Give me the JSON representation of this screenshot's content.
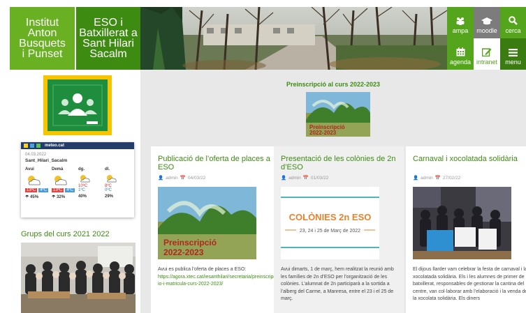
{
  "colors": {
    "green": "#55a51c",
    "dark_green": "#3d8c11",
    "gray": "#7c7c7c"
  },
  "header": {
    "logo1": [
      "Institut",
      "Anton",
      "Busquets",
      "i Punset"
    ],
    "logo2": [
      "ESO i",
      "Batxillerat a",
      "Sant Hilari",
      "Sacalm"
    ],
    "nav": {
      "ampa": {
        "label": "ampa",
        "icon": "people-icon"
      },
      "moodle": {
        "label": "moodle",
        "icon": "graduation-cap-icon"
      },
      "cerca": {
        "label": "cerca",
        "icon": "search-icon"
      },
      "agenda": {
        "label": "agenda",
        "icon": "calendar-icon"
      },
      "intranet": {
        "label": "intranet",
        "icon": "edit-icon"
      },
      "menu": {
        "label": "menu",
        "icon": "hamburger-icon"
      }
    }
  },
  "sidebar": {
    "meteo": {
      "brand": "meteo.cat",
      "date": "04.03.2022",
      "city": "Sant_Hilari_Sacalm",
      "days": [
        {
          "label": "Avui",
          "tmax": "13ºC",
          "tmin": "4ºC",
          "rain": "45%"
        },
        {
          "label": "Demà",
          "tmax": "13ºC",
          "tmin": "4ºC",
          "rain": "32%"
        },
        {
          "label": "dg.",
          "tmax": "10ºC",
          "tmin": "1ºC",
          "rain": "40%"
        },
        {
          "label": "dl.",
          "tmax": "8ºC",
          "tmin": "0ºC",
          "rain": "29%"
        }
      ]
    },
    "group_title": "Grups del curs 2021 2022"
  },
  "main": {
    "preins_title": "Preinscripció al curs 2022-2023",
    "preins_img_text": [
      "Preinscripció",
      "2022-2023"
    ],
    "posts": [
      {
        "title": "Publicació de l’oferta de places a ESO",
        "author": "admin",
        "date": "04/03/22",
        "img_text": [
          "Preinscripció",
          "2022-2023"
        ],
        "text_intro": "Avui es publica l’oferta de places a ESO:",
        "text_link": "https://agora.xtec.cat/iesanthilari/secretaria/preinscripcio-i-matricula-curs-2022-2023/"
      },
      {
        "title": "Presentació de les colònies de 2n d’ESO",
        "author": "admin",
        "date": "01/03/22",
        "img_title": "COLÒNIES 2n ESO",
        "img_sub": "23, 24 i 25 de Març de 2022",
        "text": "Avui dimarts, 1 de març, hem realitzat la reunió amb les famílies de 2n d’ESO per l’organització de les colònies. L’alumnat de 2n participarà a la sortida a l’alberg del Carme, a Manresa, entre el 23 i el 25 de març."
      },
      {
        "title": "Carnaval i xocolatada solidària",
        "author": "admin",
        "date": "27/02/22",
        "text": "El dijous llarder vam celebrar la festa de carnaval i la xocolatada solidària. Els i les alumnes de primer de batxillerat, responsables de gestionar la cantina del centre, van col·laborar amb l’elaboració i la venda de la xocolata solidària. Els diners"
      }
    ]
  }
}
